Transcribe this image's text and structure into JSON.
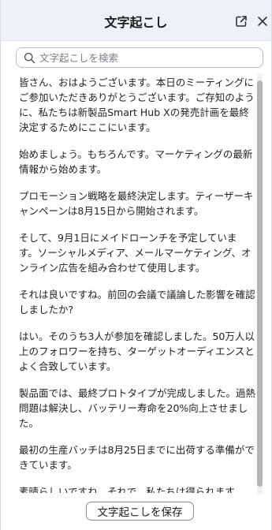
{
  "header": {
    "title": "文字起こし",
    "popout_icon": "popout-icon",
    "close_icon": "close-icon"
  },
  "search": {
    "placeholder": "文字起こしを検索",
    "value": "",
    "icon": "search-icon"
  },
  "transcript": {
    "paragraphs": [
      "皆さん、おはようございます。本日のミーティングにご参加いただきありがとうございます。ご存知のように、私たちは新製品Smart Hub Xの発売計画を最終決定するためにここにいます。",
      "始めましょう。もちろんです。マーケティングの最新情報から始めます。",
      "プロモーション戦略を最終決定します。ティーザーキャンペーンは8月15日から開始されます。",
      "そして、9月1日にメイドローンチを予定しています。ソーシャルメディア、メールマーケティング、オンライン広告を組み合わせて使用します。",
      "それは良いですね。前回の会議で議論した影響を確認しましたか?",
      "はい。そのうち3人が参加を確認しました。50万人以上のフォロワーを持ち、ターゲットオーディエンスとよく合致しています。",
      "製品面では、最終プロトタイプが完成しました。過熱問題は解決し、バッテリー寿命を20%向上させました。",
      "最初の生産バッチは8月25日までに出荷する準備ができています。",
      "素晴らしいですね。それで、私たちは得られます。"
    ]
  },
  "footer": {
    "save_label": "文字起こしを保存"
  },
  "colors": {
    "header_bg": "#eef2f6",
    "text": "#1f1f1f",
    "border": "#b9bec6",
    "scroll_thumb": "#b4b4b4"
  }
}
